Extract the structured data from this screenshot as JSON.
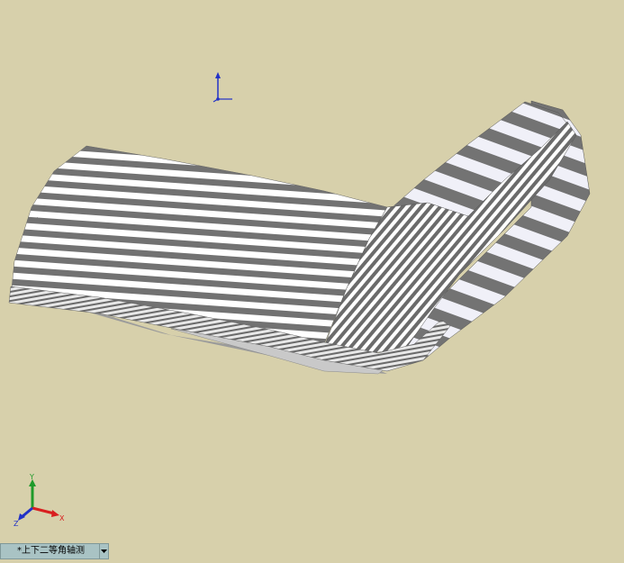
{
  "viewport": {
    "background": "#d7d0ab",
    "model": "zebra-striped-bent-surface"
  },
  "reference_triad": {
    "icon": "reference-triad-icon"
  },
  "orientation_triad": {
    "icon": "view-orientation-triad-icon",
    "x_label": "X",
    "y_label": "Y",
    "z_label": "Z",
    "x_color": "#d81f1f",
    "y_color": "#1f9a2a",
    "z_color": "#2232c7"
  },
  "view_bar": {
    "view_name": "*上下二等角轴测",
    "dropdown_icon": "chevron-down-icon"
  }
}
